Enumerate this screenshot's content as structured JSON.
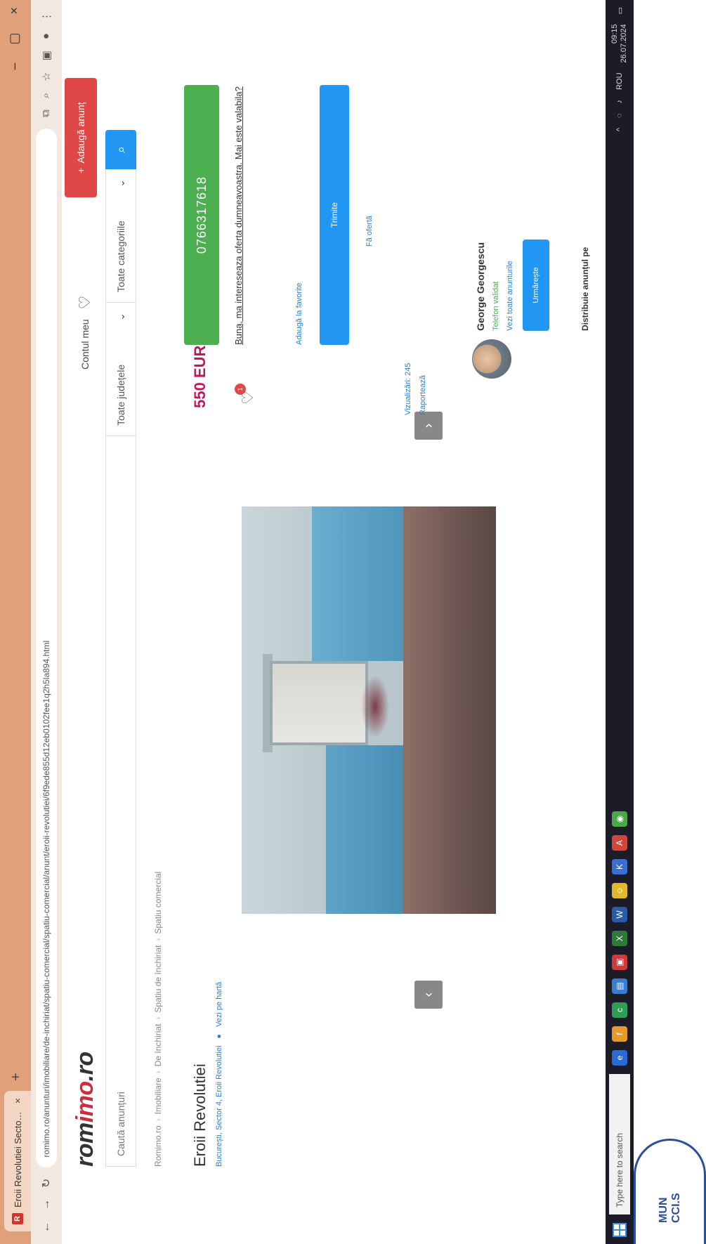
{
  "browser": {
    "tab_title": "Eroii Revolutiei Sector 4 - Ro...",
    "tab_close": "×",
    "new_tab": "+",
    "favicon_letter": "R",
    "url": "romimo.ro/anunturi/imobiliare/de-inchiriat/spatiu-comercial/spatiu-comercial/anunt/eroii-revolutiei/6f9ede855d12eb0102fee1q2h5la894.html",
    "win_minimize": "–",
    "win_maximize": "▢",
    "win_close": "×"
  },
  "header": {
    "logo_prefix": "rom",
    "logo_accent": "imo",
    "logo_suffix": ".ro",
    "account_label": "Contul meu",
    "add_button": "Adaugă anunț",
    "add_button_icon": "+"
  },
  "search": {
    "placeholder": "Caută anunțuri",
    "county": "Toate județele",
    "category": "Toate categoriile",
    "chevron": "⌄",
    "button_icon": "⌕"
  },
  "breadcrumb": [
    "Romimo.ro",
    "Imobiliare",
    "De închiriat",
    "Spatiu de închiriat",
    "Spatiu comercial"
  ],
  "breadcrumb_sep": "›",
  "listing": {
    "title": "Eroii Revolutiei",
    "location": "București, Sector 4, Eroii Revolutiei",
    "map_link": "Vezi pe hartă",
    "price": "550 EUR",
    "phone": "0766317618",
    "favorites_count": "1",
    "question": "Buna, ma intereseaza oferta dumneavoastra. Mai este valabila?",
    "favorite_link": "Adaugă la favorite",
    "message_button": "Trimite",
    "offer_link": "Fă ofertă",
    "views": "Vizualizări: 245",
    "report": "Raportează"
  },
  "seller": {
    "name": "George Georgescu",
    "phone_status": "Telefon validat",
    "all_ads": "Vezi toate anunturile",
    "follow_button": "Urmărește"
  },
  "share": {
    "label": "Distribuie anunțul pe"
  },
  "taskbar": {
    "search_placeholder": "Type here to search",
    "time": "09:15",
    "date": "26.07.2024",
    "lang": "ROU"
  },
  "stamp": {
    "line1": "MUN",
    "line2": "CCI.S"
  },
  "colors": {
    "brand_red": "#c8303f",
    "price": "#c2185b",
    "phone_green": "#4caf50",
    "primary_blue": "#2196f3",
    "add_red": "#e04848"
  }
}
